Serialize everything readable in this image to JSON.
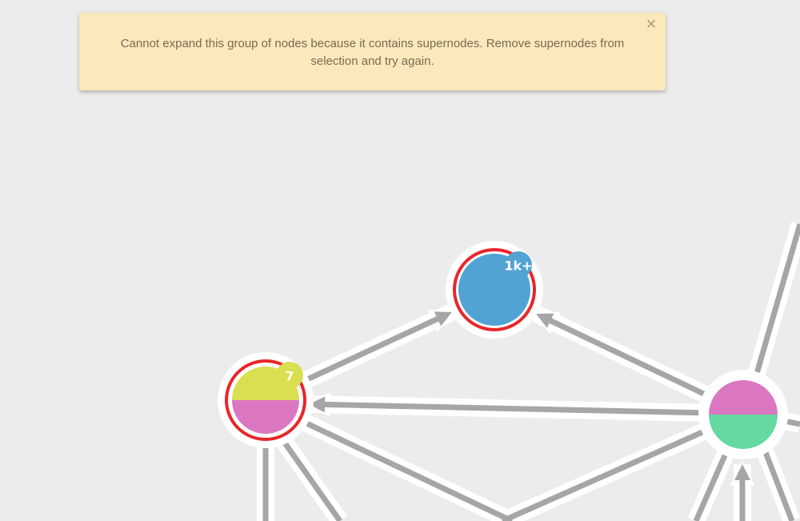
{
  "notification": {
    "message": "Cannot expand this group of nodes because it contains supernodes. Remove supernodes from selection and try again.",
    "close_glyph": "×",
    "close_icon": "close-icon",
    "background_color": "#fbe8bb",
    "text_color": "#7a6a52"
  },
  "graph": {
    "background_color": "#ececec",
    "edge_color": "#a6a6a6",
    "halo_color": "#ffffff",
    "selection_color": "#e8262a",
    "nodes": [
      {
        "name": "supernode-blue",
        "selected": true,
        "colors": [
          "#52a3d4"
        ],
        "badge": {
          "label": "1k+",
          "color": "#52a3d4"
        }
      },
      {
        "name": "group-node-yellow-pink",
        "selected": true,
        "colors": [
          "#d9df4f",
          "#db77c1"
        ],
        "badge": {
          "label": "7",
          "color": "#d9df4f"
        }
      },
      {
        "name": "node-pink-green",
        "selected": false,
        "colors": [
          "#db77c1",
          "#64d9a2"
        ],
        "badge": null
      }
    ]
  }
}
